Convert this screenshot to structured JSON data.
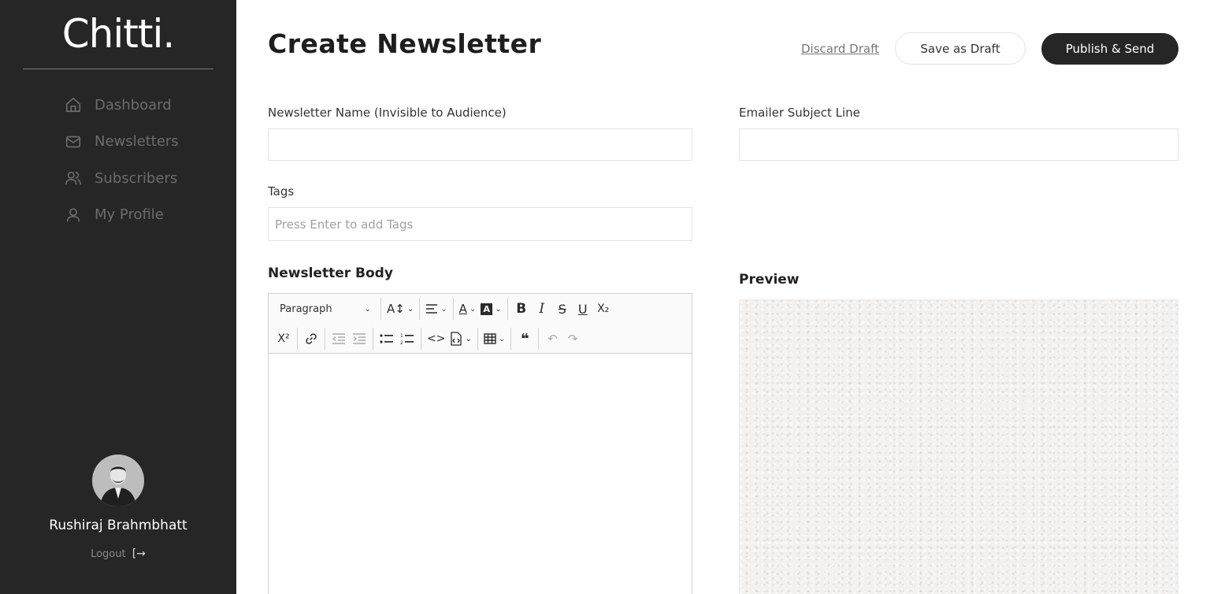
{
  "sidebar": {
    "brand": "Chitti.",
    "items": [
      {
        "label": "Dashboard",
        "icon": "home-icon"
      },
      {
        "label": "Newsletters",
        "icon": "mail-icon"
      },
      {
        "label": "Subscribers",
        "icon": "users-icon"
      },
      {
        "label": "My Profile",
        "icon": "user-icon"
      }
    ],
    "user_name": "Rushiraj Brahmbhatt",
    "logout_label": "Logout",
    "logout_icon": "logout-icon"
  },
  "header": {
    "title": "Create Newsletter",
    "discard_label": "Discard Draft",
    "save_label": "Save as Draft",
    "publish_label": "Publish & Send"
  },
  "form": {
    "name_label": "Newsletter Name (Invisible to Audience)",
    "name_value": "",
    "subject_label": "Emailer Subject Line",
    "subject_value": "",
    "tags_label": "Tags",
    "tags_placeholder": "Press Enter to add Tags",
    "body_label": "Newsletter Body",
    "preview_label": "Preview"
  },
  "toolbar": {
    "paragraph": "Paragraph",
    "bold": "B",
    "italic": "I",
    "strike": "S",
    "underline": "U",
    "subscript": "X₂",
    "superscript": "X²"
  },
  "colors": {
    "sidebar_bg": "#262626",
    "accent": "#262626",
    "nav_text": "#6c6c6c"
  }
}
